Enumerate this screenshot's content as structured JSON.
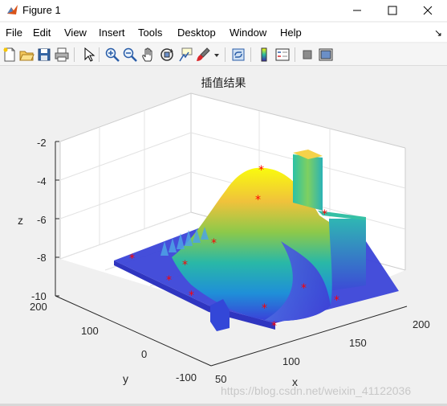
{
  "window": {
    "title": "Figure 1"
  },
  "menu": [
    "File",
    "Edit",
    "View",
    "Insert",
    "Tools",
    "Desktop",
    "Window",
    "Help"
  ],
  "menu_arrow": "↘",
  "toolbar_icons": [
    "new-figure-icon",
    "open-file-icon",
    "save-icon",
    "print-icon",
    "edit-plot-arrow-icon",
    "zoom-in-icon",
    "zoom-out-icon",
    "pan-hand-icon",
    "rotate-3d-icon",
    "data-cursor-icon",
    "brush-icon",
    "brush-dropdown-icon",
    "link-plot-icon",
    "insert-colorbar-icon",
    "insert-legend-icon",
    "hide-plot-tools-icon",
    "show-plot-tools-icon"
  ],
  "chart_data": {
    "type": "surface",
    "title": "插值结果",
    "xlabel": "x",
    "ylabel": "y",
    "zlabel": "z",
    "xticks": [
      "50",
      "100",
      "150",
      "200"
    ],
    "yticks": [
      "-100",
      "0",
      "100",
      "200"
    ],
    "zticks": [
      "-2",
      "-4",
      "-6",
      "-8",
      "-10"
    ],
    "xlim": [
      50,
      200
    ],
    "ylim": [
      -100,
      200
    ],
    "zlim": [
      -10,
      -2
    ],
    "grid": true,
    "colormap": "parula",
    "marker_color": "#ff0000"
  },
  "watermark": "https://blog.csdn.net/weixin_41122036"
}
